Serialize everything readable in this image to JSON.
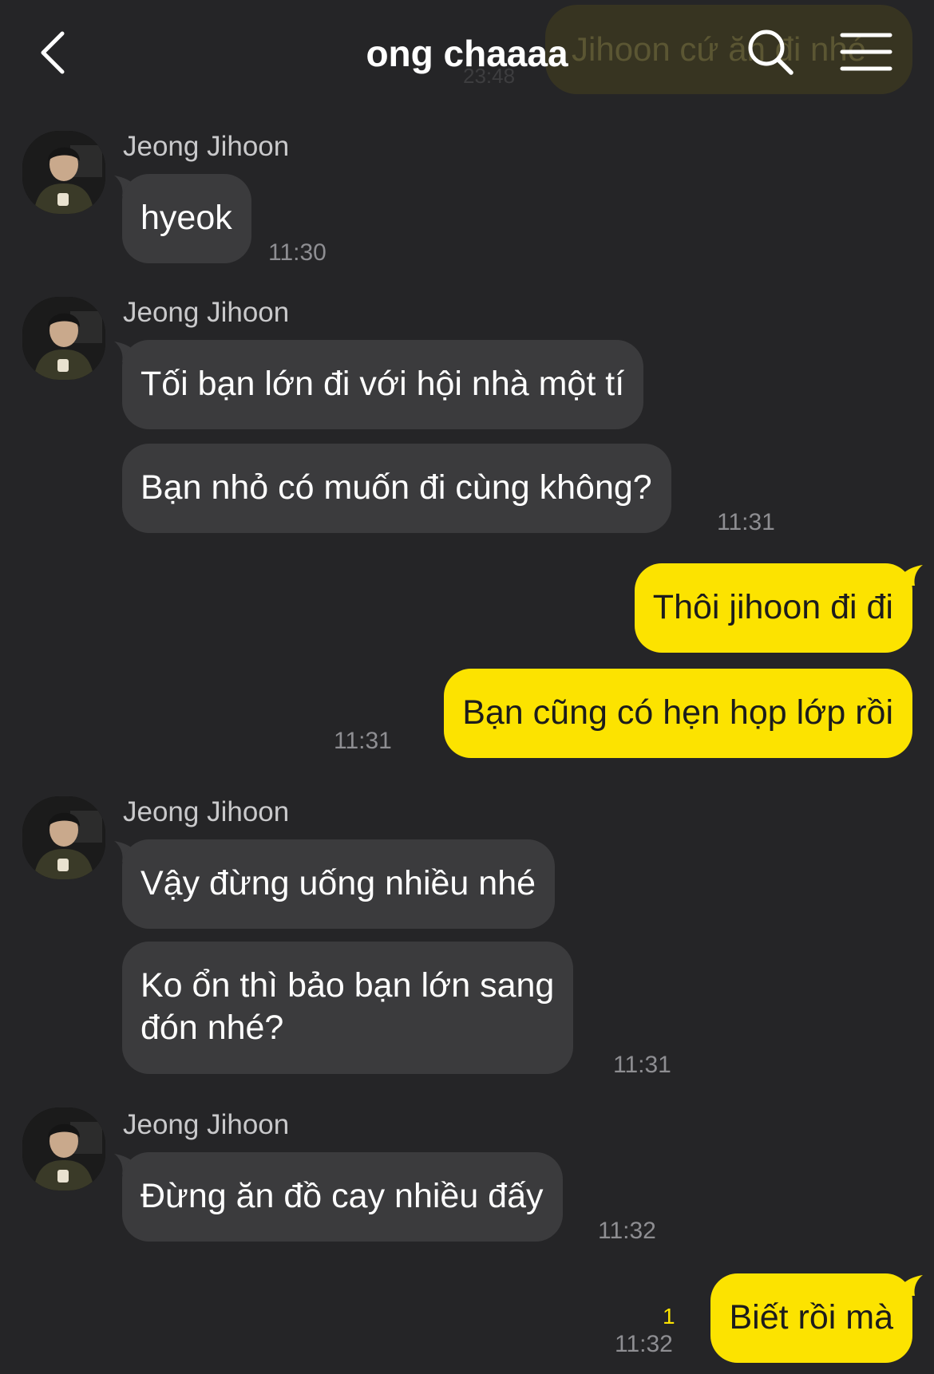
{
  "header": {
    "title": "ong chaaaa",
    "back_icon": "chevron-left-icon",
    "search_icon": "search-icon",
    "menu_icon": "hamburger-menu-icon"
  },
  "background_preview": {
    "text": "Jihoon cứ ăn đi nhé",
    "time": "23:48"
  },
  "colors": {
    "background": "#252527",
    "incoming_bubble": "#3b3b3d",
    "outgoing_bubble": "#fce300",
    "timestamp": "#8e8e92",
    "unread_count": "#fce300"
  },
  "messages": {
    "g1": {
      "sender": "Jeong Jihoon",
      "b1": "hyeok",
      "time": "11:30"
    },
    "g2": {
      "sender": "Jeong Jihoon",
      "b1": "Tối bạn lớn đi với hội nhà một tí",
      "b2": "Bạn nhỏ có muốn đi cùng không?",
      "time": "11:31"
    },
    "g3": {
      "b1": "Thôi jihoon đi đi",
      "b2": "Bạn cũng có hẹn họp lớp rồi",
      "time": "11:31"
    },
    "g4": {
      "sender": "Jeong Jihoon",
      "b1": "Vậy đừng uống nhiều nhé",
      "b2_line1": "Ko ổn thì bảo bạn lớn sang",
      "b2_line2": "đón nhé?",
      "time": "11:31"
    },
    "g5": {
      "sender": "Jeong Jihoon",
      "b1": "Đừng ăn đồ cay nhiều đấy",
      "time": "11:32"
    },
    "g6": {
      "b1": "Biết rồi mà",
      "unread": "1",
      "time": "11:32"
    }
  }
}
